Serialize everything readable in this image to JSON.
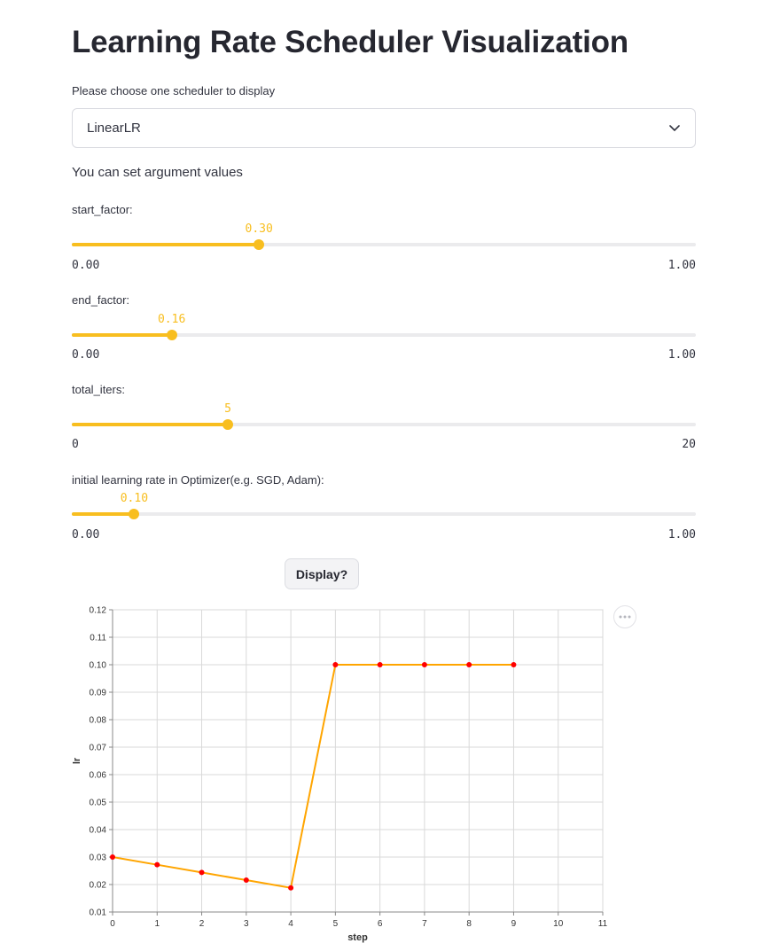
{
  "page": {
    "title": "Learning Rate Scheduler Visualization"
  },
  "scheduler_select": {
    "label": "Please choose one scheduler to display",
    "value": "LinearLR",
    "chevron_icon": "chevron-down-icon"
  },
  "args_intro": "You can set argument values",
  "sliders": [
    {
      "label": "start_factor:",
      "value": "0.30",
      "value_num": 0.3,
      "min": "0.00",
      "max": "1.00",
      "min_num": 0,
      "max_num": 1
    },
    {
      "label": "end_factor:",
      "value": "0.16",
      "value_num": 0.16,
      "min": "0.00",
      "max": "1.00",
      "min_num": 0,
      "max_num": 1
    },
    {
      "label": "total_iters:",
      "value": "5",
      "value_num": 5,
      "min": "0",
      "max": "20",
      "min_num": 0,
      "max_num": 20
    },
    {
      "label": "initial learning rate in Optimizer(e.g. SGD, Adam):",
      "value": "0.10",
      "value_num": 0.1,
      "min": "0.00",
      "max": "1.00",
      "min_num": 0,
      "max_num": 1
    }
  ],
  "display_button": {
    "label": "Display?"
  },
  "chart_menu": {
    "icon": "more-horizontal-icon"
  },
  "colors": {
    "accent": "#f8be1f",
    "line": "#ffa500",
    "marker": "#ff0000"
  },
  "chart_data": {
    "type": "line",
    "xlabel": "step",
    "ylabel": "lr",
    "xlim": [
      0,
      11
    ],
    "ylim": [
      0.01,
      0.12
    ],
    "x_ticks": [
      "0",
      "1",
      "2",
      "3",
      "4",
      "5",
      "6",
      "7",
      "8",
      "9",
      "10",
      "11"
    ],
    "y_ticks": [
      "0.01",
      "0.02",
      "0.03",
      "0.04",
      "0.05",
      "0.06",
      "0.07",
      "0.08",
      "0.09",
      "0.10",
      "0.11",
      "0.12"
    ],
    "grid": true,
    "series": [
      {
        "x": [
          0,
          1,
          2,
          3,
          4,
          5,
          6,
          7,
          8,
          9
        ],
        "y": [
          0.03,
          0.0272,
          0.0244,
          0.0216,
          0.0188,
          0.1,
          0.1,
          0.1,
          0.1,
          0.1
        ]
      }
    ]
  }
}
